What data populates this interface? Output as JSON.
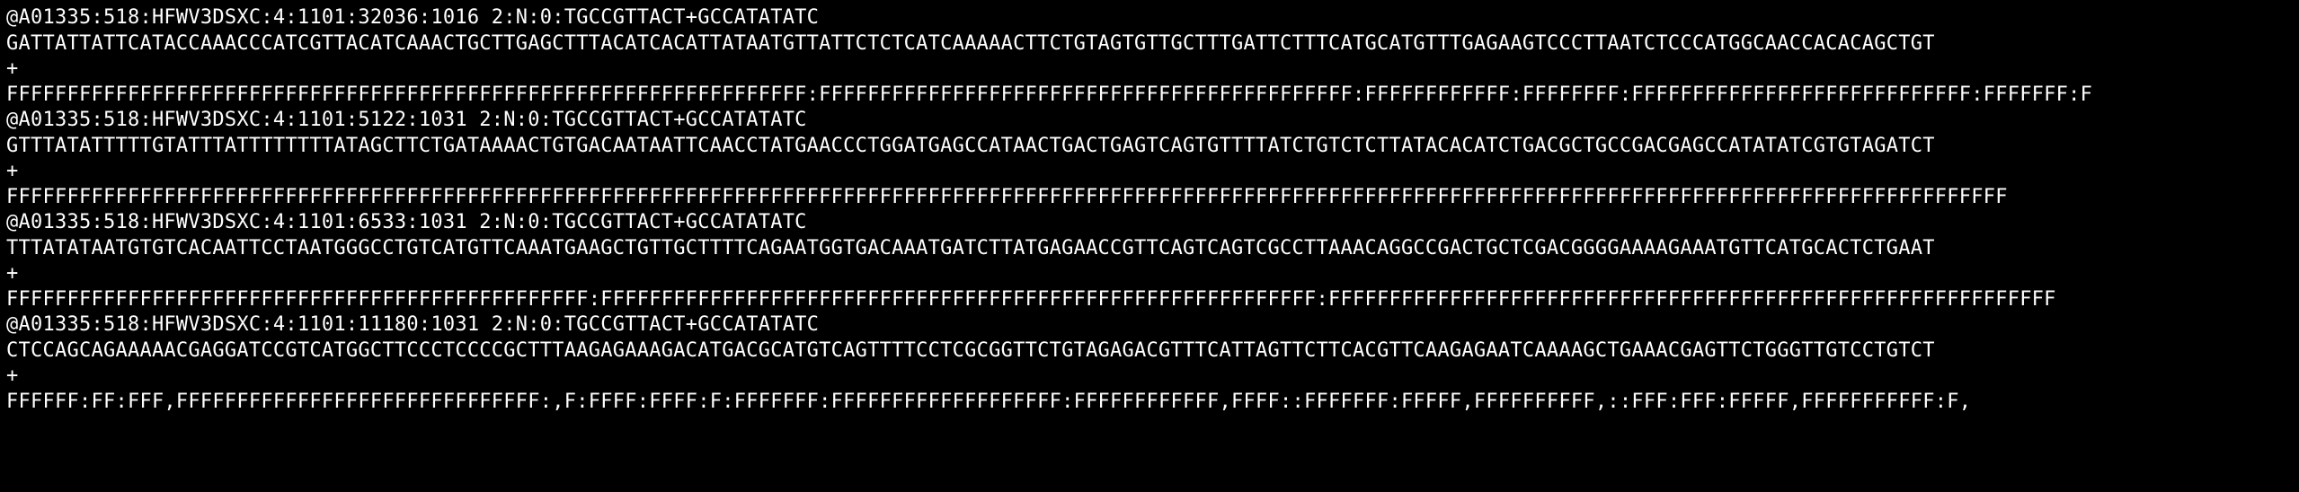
{
  "terminal": {
    "background": "#000000",
    "foreground": "#ffffff",
    "records": [
      {
        "header": "@A01335:518:HFWV3DSXC:4:1101:32036:1016 2:N:0:TGCCGTTACT+GCCATATATC",
        "sequence": "GATTATTATTCATACCAAACCCATCGTTACATCAAACTGCTTGAGCTTTACATCACATTATAATGTTATTCTCTCATCAAAAACTTCTGTAGTGTTGCTTTGATTCTTTCATGCATGTTTGAGAAGTCCCTTAATCTCCCATGGCAACCACACAGCTGT",
        "separator": "+",
        "quality": "FFFFFFFFFFFFFFFFFFFFFFFFFFFFFFFFFFFFFFFFFFFFFFFFFFFFFFFFFFFFFFFFFF:FFFFFFFFFFFFFFFFFFFFFFFFFFFFFFFFFFFFFFFFFFFF:FFFFFFFFFFFF:FFFFFFFF:FFFFFFFFFFFFFFFFFFFFFFFFFFFF:FFFFFFF:F"
      },
      {
        "header": "@A01335:518:HFWV3DSXC:4:1101:5122:1031 2:N:0:TGCCGTTACT+GCCATATATC",
        "sequence": "GTTTATATTTTTGTATTTATTTTTTTTATAGCTTCTGATAAAACTGTGACAATAATTCAACCTATGAACCCTGGATGAGCCATAACTGACTGAGTCAGTGTTTTATCTGTCTCTTATACACATCTGACGCTGCCGACGAGCCATATATCGTGTAGATCT",
        "separator": "+",
        "quality": "FFFFFFFFFFFFFFFFFFFFFFFFFFFFFFFFFFFFFFFFFFFFFFFFFFFFFFFFFFFFFFFFFFFFFFFFFFFFFFFFFFFFFFFFFFFFFFFFFFFFFFFFFFFFFFFFFFFFFFFFFFFFFFFFFFFFFFFFFFFFFFFFFFFFFFFFFFFFFFFFFFFFF"
      },
      {
        "header": "@A01335:518:HFWV3DSXC:4:1101:6533:1031 2:N:0:TGCCGTTACT+GCCATATATC",
        "sequence": "TTTATATAATGTGTCACAATTCCTAATGGGCCTGTCATGTTCAAATGAAGCTGTTGCTTTTCAGAATGGTGACAAATGATCTTATGAGAACCGTTCAGTCAGTCGCCTTAAACAGGCCGACTGCTCGACGGGGAAAAGAAATGTTCATGCACTCTGAAT",
        "separator": "+",
        "quality": "FFFFFFFFFFFFFFFFFFFFFFFFFFFFFFFFFFFFFFFFFFFFFFFF:FFFFFFFFFFFFFFFFFFFFFFFFFFFFFFFFFFFFFFFFFFFFFFFFFFFFFFFFFFF:FFFFFFFFFFFFFFFFFFFFFFFFFFFFFFFFFFFFFFFFFFFFFFFFFFFFFFFFFFFF"
      },
      {
        "header": "@A01335:518:HFWV3DSXC:4:1101:11180:1031 2:N:0:TGCCGTTACT+GCCATATATC",
        "sequence": "CTCCAGCAGAAAAACGAGGATCCGTCATGGCTTCCCTCCCCGCTTTAAGAGAAAGACATGACGCATGTCAGTTTTCCTCGCGGTTCTGTAGAGACGTTTCATTAGTTCTTCACGTTCAAGAGAATCAAAAGCTGAAACGAGTTCTGGGTTGTCCTGTCT",
        "separator": "+",
        "quality": "FFFFFF:FF:FFF,FFFFFFFFFFFFFFFFFFFFFFFFFFFFFF:,F:FFFF:FFFF:F:FFFFFFF:FFFFFFFFFFFFFFFFFFF:FFFFFFFFFFFF,FFFF::FFFFFFF:FFFFF,FFFFFFFFFF,::FFF:FFF:FFFFF,FFFFFFFFFFF:F,"
      }
    ]
  }
}
